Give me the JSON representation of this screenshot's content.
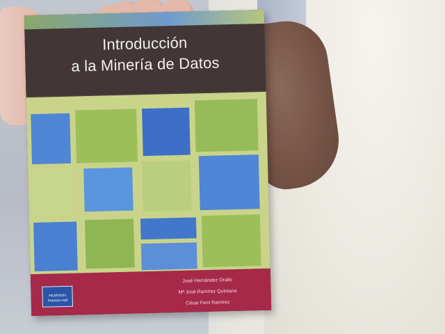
{
  "book": {
    "title_line1": "Introducción",
    "title_line2": "a la Minería de Datos",
    "authors": [
      "José Hernández Orallo",
      "Mª José Ramírez Quintana",
      "César Ferri Ramírez"
    ],
    "publisher_logo_text": "PEARSON Prentice Hall"
  },
  "colors": {
    "title_band": "#423736",
    "footer": "#a6294a",
    "tile_blue": "#4f86d6",
    "tile_green": "#9cbf5a",
    "tile_light": "#c9d48a"
  }
}
